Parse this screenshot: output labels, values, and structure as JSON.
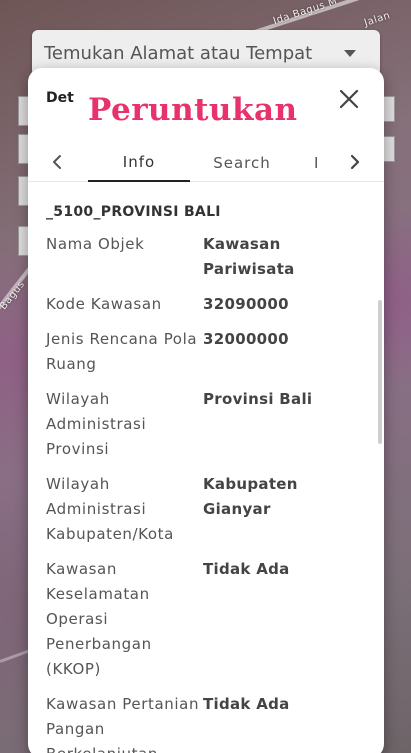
{
  "map": {
    "road_label_1": "Ida Bagus M",
    "road_label_2": "Jalan",
    "road_label_3": "Bagus"
  },
  "search": {
    "placeholder": "Temukan Alamat atau Tempat"
  },
  "panel": {
    "header_short": "Det",
    "heading": "Peruntukan",
    "tabs": [
      {
        "label": "Info",
        "active": true
      },
      {
        "label": "Search",
        "active": false
      },
      {
        "label": "I",
        "active": false
      }
    ],
    "layer_title": "_5100_PROVINSI BALI",
    "rows": [
      {
        "label": "Nama Objek",
        "value": "Kawasan Pariwisata"
      },
      {
        "label": "Kode Kawasan",
        "value": "32090000"
      },
      {
        "label": "Jenis Rencana Pola Ruang",
        "value": "32000000"
      },
      {
        "label": "Wilayah Administrasi Provinsi",
        "value": "Provinsi Bali"
      },
      {
        "label": "Wilayah Administrasi Kabupaten/Kota",
        "value": "Kabupaten Gianyar"
      },
      {
        "label": "Kawasan Keselamatan Operasi Penerbangan (KKOP)",
        "value": "Tidak Ada"
      },
      {
        "label": "Kawasan Pertanian Pangan Berkelanjutan",
        "value": "Tidak Ada"
      }
    ]
  },
  "colors": {
    "heading": "#e8326c",
    "panel_bg": "#ffffff"
  },
  "icons": {
    "close": "close-icon",
    "prev": "chevron-left-icon",
    "next": "chevron-right-icon",
    "dropdown": "caret-down-icon"
  }
}
